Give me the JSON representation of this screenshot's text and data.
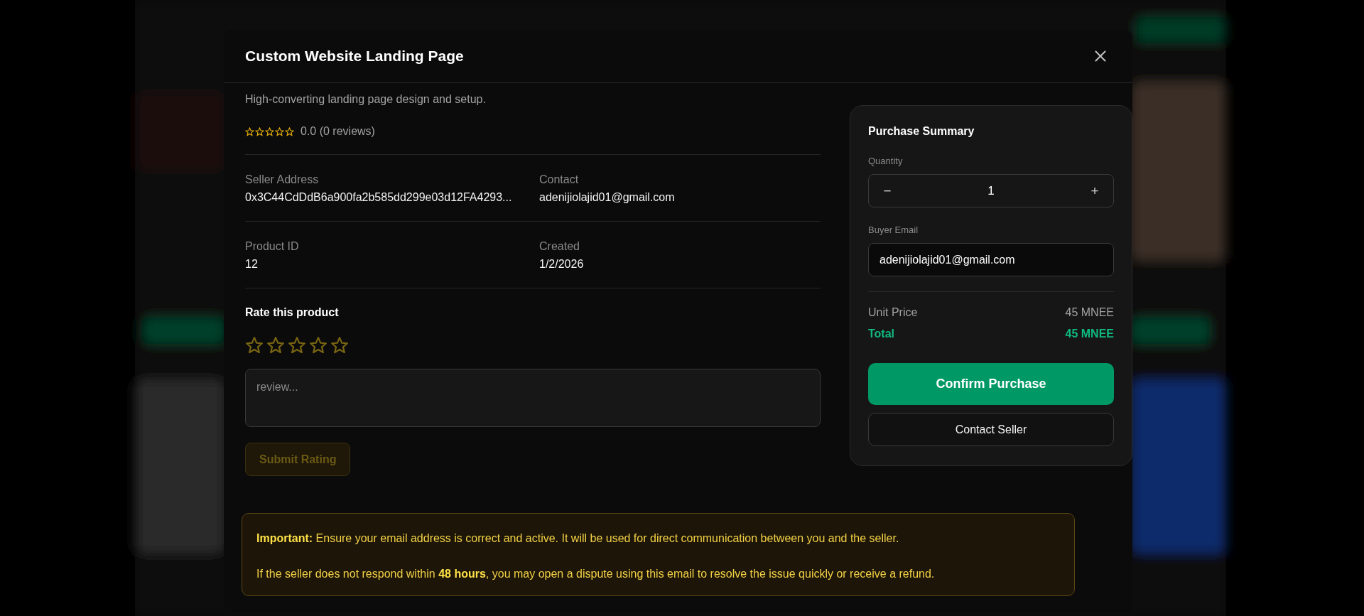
{
  "dialog": {
    "title": "Custom Website Landing Page"
  },
  "description": "High-converting landing page design and setup.",
  "rating": {
    "stars": 0,
    "summary": "0.0 (0 reviews)"
  },
  "details": [
    {
      "label": "Seller Address",
      "value": "0x3C44CdDdB6a900fa2b585dd299e03d12FA4293..."
    },
    {
      "label": "Contact",
      "value": "adenijiolajid01@gmail.com"
    },
    {
      "label": "Product ID",
      "value": "12"
    },
    {
      "label": "Created",
      "value": "1/2/2026"
    }
  ],
  "rate": {
    "heading": "Rate this product",
    "stars": 0,
    "review_placeholder": "review...",
    "submit": {
      "label": "Submit Rating",
      "disabled": true
    }
  },
  "purchase_summary": {
    "title": "Purchase Summary",
    "quantity_label": "Quantity",
    "decrement": "−",
    "quantity": "1",
    "increment": "+",
    "email_label": "Buyer Email",
    "email": "adenijiolajid01@gmail.com",
    "unit_price_label": "Unit Price",
    "unit_price": "45 MNEE",
    "total_label": "Total",
    "total": "45 MNEE",
    "confirm": "Confirm Purchase",
    "contact": "Contact Seller"
  },
  "notice": [
    "**Important:** Ensure your email address is correct and active. It will be used for direct communication between you and the seller.",
    "If the seller does not respond within **48 hours**, you may open a dispute using this email to resolve the issue quickly or receive a refund."
  ]
}
